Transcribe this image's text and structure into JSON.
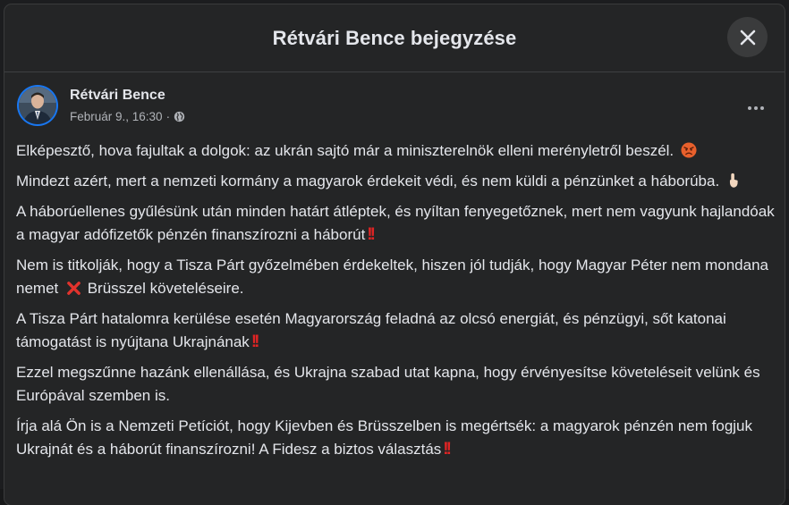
{
  "modal": {
    "title": "Rétvári Bence bejegyzése"
  },
  "post": {
    "author": "Rétvári Bence",
    "date": "Február 9., 16:30",
    "meta_separator": "·",
    "paragraphs": [
      {
        "text": "Elképesztő, hova fajultak a dolgok: az ukrán sajtó már a miniszterelnök elleni merényletről beszél.",
        "emoji": "angry-face"
      },
      {
        "text": "Mindezt azért, mert a nemzeti kormány a magyarok érdekeit védi, és nem küldi a pénzünket a háborúba.",
        "emoji": "pointing-up-hand"
      },
      {
        "text": "A háborúellenes gyűlésünk után minden határt átléptek, és nyíltan fenyegetőznek, mert nem vagyunk hajlandóak a magyar adófizetők pénzén finanszírozni a háborút",
        "emoji": "double-exclamation"
      },
      {
        "text_before": "Nem is titkolják, hogy a Tisza Párt győzelmében érdekeltek, hiszen jól tudják, hogy Magyar Péter nem mondana nemet",
        "emoji": "cross-mark",
        "text_after": "Brüsszel követeléseire."
      },
      {
        "text": "A Tisza Párt hatalomra kerülése esetén Magyarország feladná az olcsó energiát, és pénzügyi, sőt katonai támogatást is nyújtana Ukrajnának",
        "emoji": "double-exclamation"
      },
      {
        "text": "Ezzel megszűnne hazánk ellenállása, és Ukrajna szabad utat kapna, hogy érvényesítse követeléseit velünk és Európával szemben is."
      },
      {
        "text": "Írja alá Ön is a Nemzeti Petíciót, hogy Kijevben és Brüsszelben is megértsék: a magyarok pénzén nem fogjuk Ukrajnát és a háborút finanszírozni! A Fidesz a biztos választás",
        "emoji": "double-exclamation"
      }
    ]
  },
  "icons": {
    "close": "close-icon",
    "more": "more-horizontal-icon",
    "privacy": "globe-icon"
  },
  "colors": {
    "background": "#242526",
    "text_primary": "#e4e6eb",
    "text_secondary": "#b0b3b8",
    "accent": "#1877f2",
    "emoji_red": "#e02424"
  }
}
